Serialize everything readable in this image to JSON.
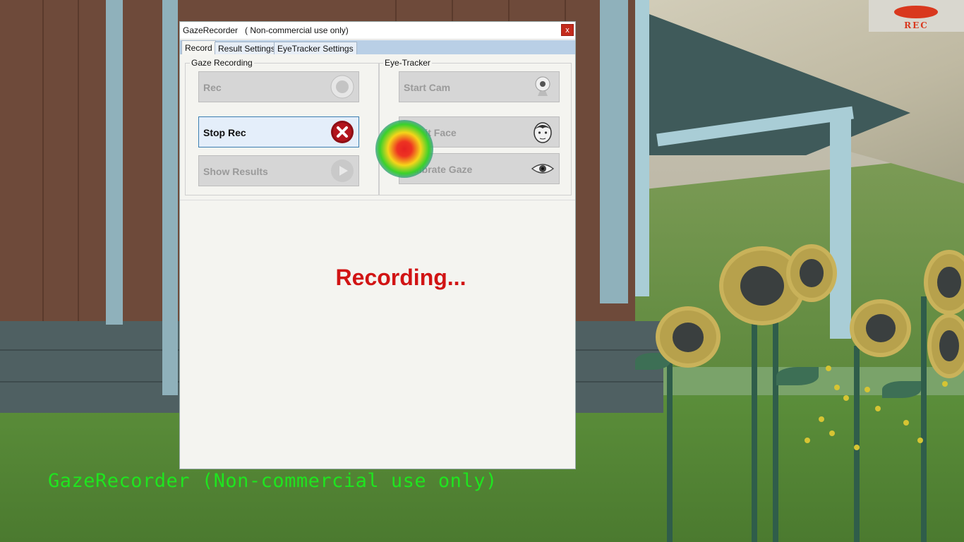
{
  "window": {
    "title": "GazeRecorder   ( Non-commercial use only)",
    "close_label": "x",
    "tabs": [
      {
        "label": "Record",
        "active": true
      },
      {
        "label": "Result Settings",
        "active": false
      },
      {
        "label": "EyeTracker Settings",
        "active": false
      }
    ]
  },
  "gaze_recording": {
    "group_label": "Gaze Recording",
    "buttons": [
      {
        "label": "Rec",
        "icon": "record-icon",
        "enabled": false
      },
      {
        "label": "Stop Rec",
        "icon": "stop-icon",
        "enabled": true
      },
      {
        "label": "Show Results",
        "icon": "play-icon",
        "enabled": false
      }
    ]
  },
  "eye_tracker": {
    "group_label": "Eye-Tracker",
    "buttons": [
      {
        "label": "Start Cam",
        "icon": "webcam-icon",
        "enabled": false
      },
      {
        "label": "Reinit Face",
        "icon": "face-icon",
        "enabled": false
      },
      {
        "label": "Calibrate Gaze",
        "icon": "eye-icon",
        "enabled": false
      }
    ]
  },
  "status": {
    "text": "Recording...",
    "color": "#d11414"
  },
  "rec_badge": {
    "label": "REC",
    "color": "#d9381e"
  },
  "overlay": {
    "text": "GazeRecorder (Non-commercial use only)",
    "color": "#1fe51f"
  }
}
